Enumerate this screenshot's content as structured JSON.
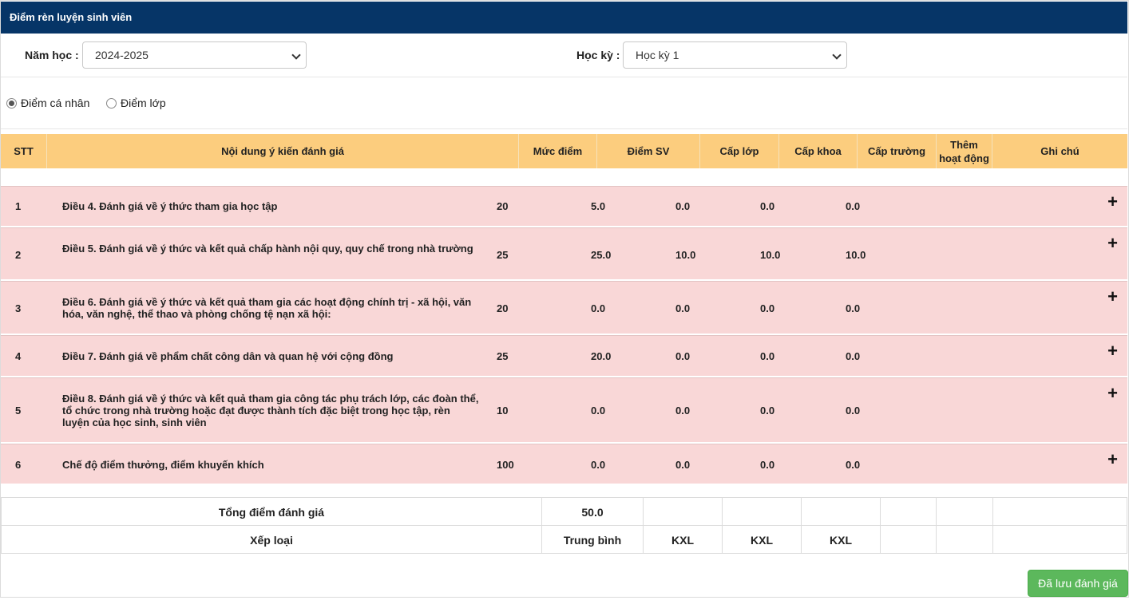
{
  "header": {
    "title": "Điểm rèn luyện sinh viên"
  },
  "filters": {
    "year_label": "Năm học :",
    "year_value": "2024-2025",
    "semester_label": "Học kỳ :",
    "semester_value": "Học kỳ 1"
  },
  "mode": {
    "options": [
      {
        "label": "Điểm cá nhân",
        "selected": true
      },
      {
        "label": "Điểm lớp",
        "selected": false
      }
    ]
  },
  "table": {
    "headers": {
      "stt": "STT",
      "content": "Nội dung ý kiến đánh giá",
      "max": "Mức điểm",
      "sv": "Điểm SV",
      "lop": "Cấp lớp",
      "khoa": "Cấp khoa",
      "truong": "Cấp trường",
      "them_line1": "Thêm",
      "them_line2": "hoạt động",
      "note": "Ghi chú"
    },
    "rows": [
      {
        "stt": "1",
        "content": "Điều 4. Đánh giá về ý thức tham gia học tập",
        "max": "20",
        "sv": "5.0",
        "lop": "0.0",
        "khoa": "0.0",
        "truong": "0.0"
      },
      {
        "stt": "2",
        "content": "Điều 5. Đánh giá về ý thức và kết quả chấp hành nội quy, quy chế trong nhà trường",
        "max": "25",
        "sv": "25.0",
        "lop": "10.0",
        "khoa": "10.0",
        "truong": "10.0"
      },
      {
        "stt": "3",
        "content": "Điều 6. Đánh giá về ý thức và kết quả tham gia các hoạt động chính trị - xã hội, văn hóa, văn nghệ, thể thao và phòng chống tệ nạn xã hội:",
        "max": "20",
        "sv": "0.0",
        "lop": "0.0",
        "khoa": "0.0",
        "truong": "0.0"
      },
      {
        "stt": "4",
        "content": "Điều 7. Đánh giá về phẩm chất công dân và quan hệ với cộng đồng",
        "max": "25",
        "sv": "20.0",
        "lop": "0.0",
        "khoa": "0.0",
        "truong": "0.0"
      },
      {
        "stt": "5",
        "content": "Điều 8. Đánh giá về ý thức và kết quả tham gia công tác phụ trách lớp, các đoàn thể, tổ chức trong nhà trường hoặc đạt được thành tích đặc biệt trong học tập, rèn luyện của học sinh, sinh viên",
        "max": "10",
        "sv": "0.0",
        "lop": "0.0",
        "khoa": "0.0",
        "truong": "0.0"
      },
      {
        "stt": "6",
        "content": "Chế độ điểm thưởng, điểm khuyến khích",
        "max": "100",
        "sv": "0.0",
        "lop": "0.0",
        "khoa": "0.0",
        "truong": "0.0"
      }
    ],
    "row_action_icon": "plus-icon",
    "row_action_glyph": "+"
  },
  "summary": {
    "total_label": "Tổng điểm đánh giá",
    "total_value": "50.0",
    "rank_label": "Xếp loại",
    "rank_values": [
      "Trung bình",
      "KXL",
      "KXL",
      "KXL"
    ]
  },
  "actions": {
    "save_label": "Đã lưu đánh giá"
  },
  "colors": {
    "header_bg": "#063567",
    "table_header_bg": "#fccd7e",
    "row_bg": "#f9d7d7",
    "save_button_bg": "#5cb85c"
  }
}
